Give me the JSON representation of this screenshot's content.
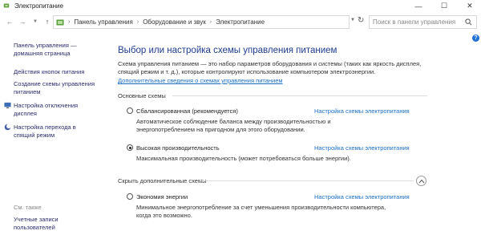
{
  "window": {
    "title": "Электропитание",
    "controls": {
      "minimize": "—",
      "maximize": "☐",
      "close": "✕"
    }
  },
  "address": {
    "breadcrumbs": [
      "Панель управления",
      "Оборудование и звук",
      "Электропитание"
    ],
    "search_placeholder": "Поиск в панели управления"
  },
  "sidebar": {
    "home": "Панель управления — домашняя страница",
    "links": [
      {
        "label": "Действия кнопок питания",
        "icon": ""
      },
      {
        "label": "Создание схемы управления питанием",
        "icon": ""
      },
      {
        "label": "Настройка отключения дисплея",
        "icon": "monitor-icon"
      },
      {
        "label": "Настройка перехода в спящий режим",
        "icon": "moon-icon"
      }
    ],
    "see_also": "См. также",
    "user_accounts": "Учетные записи пользователей"
  },
  "main": {
    "title": "Выбор или настройка схемы управления питанием",
    "intro": "Схема управления питанием — это набор параметров оборудования и системы (таких как яркость дисплея, спящий режим и т. д.), которые контролируют использование компьютером электроэнергии.",
    "intro_link": "Дополнительные сведения о схемах управления питанием",
    "primary_group": "Основные схемы",
    "hidden_group": "Скрыть дополнительные схемы",
    "plans": [
      {
        "name": "Сбалансированная (рекомендуется)",
        "description": "Автоматическое соблюдение баланса между производительностью и энергопотреблением на пригодном для этого оборудовании.",
        "link": "Настройка схемы электропитания",
        "selected": false
      },
      {
        "name": "Высокая производительность",
        "description": "Максимальная производительность (может потребоваться больше энергии).",
        "link": "Настройка схемы электропитания",
        "selected": true
      },
      {
        "name": "Экономия энергии",
        "description": "Минимальное энергопотребление за счет уменьшения производительности компьютера, когда это возможно.",
        "link": "Настройка схемы электропитания",
        "selected": false
      }
    ]
  },
  "colors": {
    "link": "#1a6fc4",
    "title": "#1f3d8f",
    "help": "#1e6fd9"
  }
}
